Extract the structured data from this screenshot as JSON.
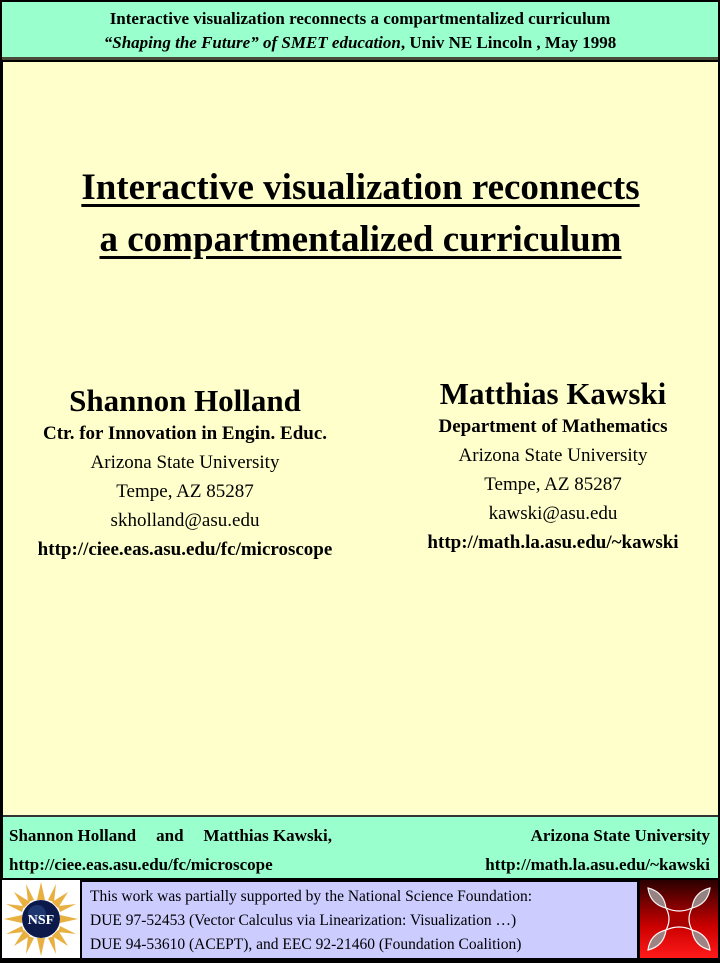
{
  "header": {
    "line1": "Interactive visualization reconnects a compartmentalized curriculum",
    "line2_italic": "“Shaping the Future” of SMET education",
    "line2_rest": ", Univ NE Lincoln , May 1998"
  },
  "title": {
    "line1": "Interactive visualization reconnects",
    "line2": "a compartmentalized curriculum"
  },
  "authors": [
    {
      "name": "Shannon Holland",
      "dept": "Ctr. for Innovation in Engin. Educ.",
      "university": "Arizona State University",
      "city": "Tempe, AZ 85287",
      "email": "skholland@asu.edu",
      "url": "http://ciee.eas.asu.edu/fc/microscope"
    },
    {
      "name": "Matthias Kawski",
      "dept": "Department of Mathematics",
      "university": "Arizona State University",
      "city": "Tempe, AZ 85287",
      "email": "kawski@asu.edu",
      "url": "http://math.la.asu.edu/~kawski"
    }
  ],
  "footer": {
    "name1": "Shannon Holland",
    "and": "and",
    "name2": "Matthias Kawski,",
    "university": "Arizona State University",
    "url1": "http://ciee.eas.asu.edu/fc/microscope",
    "url2": "http://math.la.asu.edu/~kawski"
  },
  "grant": {
    "line1": "This work was partially supported by the National Science Foundation:",
    "line2": "DUE 97-52453 (Vector Calculus via Linearization: Visualization …)",
    "line3": "DUE 94-53610 (ACEPT), and EEC 92-21460 (Foundation Coalition)",
    "nsf_logo_text": "NSF"
  },
  "colors": {
    "header_bg": "#99ffcc",
    "main_bg": "#ffffcc",
    "grant_bg": "#ccccff",
    "logo_red": "#cc0000"
  }
}
